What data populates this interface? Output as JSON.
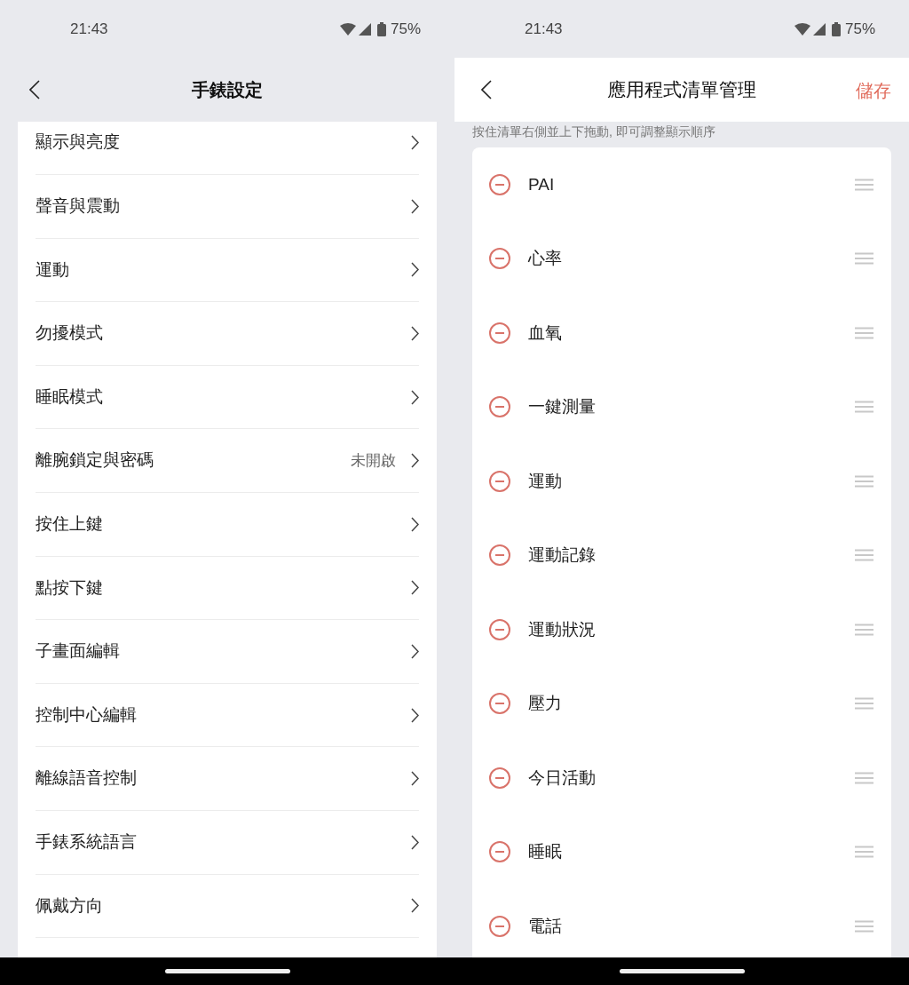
{
  "left_screen": {
    "status_bar": {
      "time": "21:43",
      "battery": "75%"
    },
    "header": {
      "title": "手錶設定"
    },
    "items": [
      {
        "label": "顯示與亮度"
      },
      {
        "label": "聲音與震動"
      },
      {
        "label": "運動"
      },
      {
        "label": "勿擾模式"
      },
      {
        "label": "睡眠模式"
      },
      {
        "label": "離腕鎖定與密碼",
        "value": "未開啟"
      },
      {
        "label": "按住上鍵"
      },
      {
        "label": "點按下鍵"
      },
      {
        "label": "子畫面編輯"
      },
      {
        "label": "控制中心編輯"
      },
      {
        "label": "離線語音控制"
      },
      {
        "label": "手錶系統語言"
      },
      {
        "label": "佩戴方向"
      }
    ]
  },
  "right_screen": {
    "status_bar": {
      "time": "21:43",
      "battery": "75%"
    },
    "header": {
      "title": "應用程式清單管理",
      "action": "儲存"
    },
    "hint": "按住清單右側並上下拖動, 即可調整顯示順序",
    "apps": [
      {
        "label": "PAI"
      },
      {
        "label": "心率"
      },
      {
        "label": "血氧"
      },
      {
        "label": "一鍵測量"
      },
      {
        "label": "運動"
      },
      {
        "label": "運動記錄"
      },
      {
        "label": "運動狀況"
      },
      {
        "label": "壓力"
      },
      {
        "label": "今日活動"
      },
      {
        "label": "睡眠"
      },
      {
        "label": "電話"
      }
    ]
  }
}
